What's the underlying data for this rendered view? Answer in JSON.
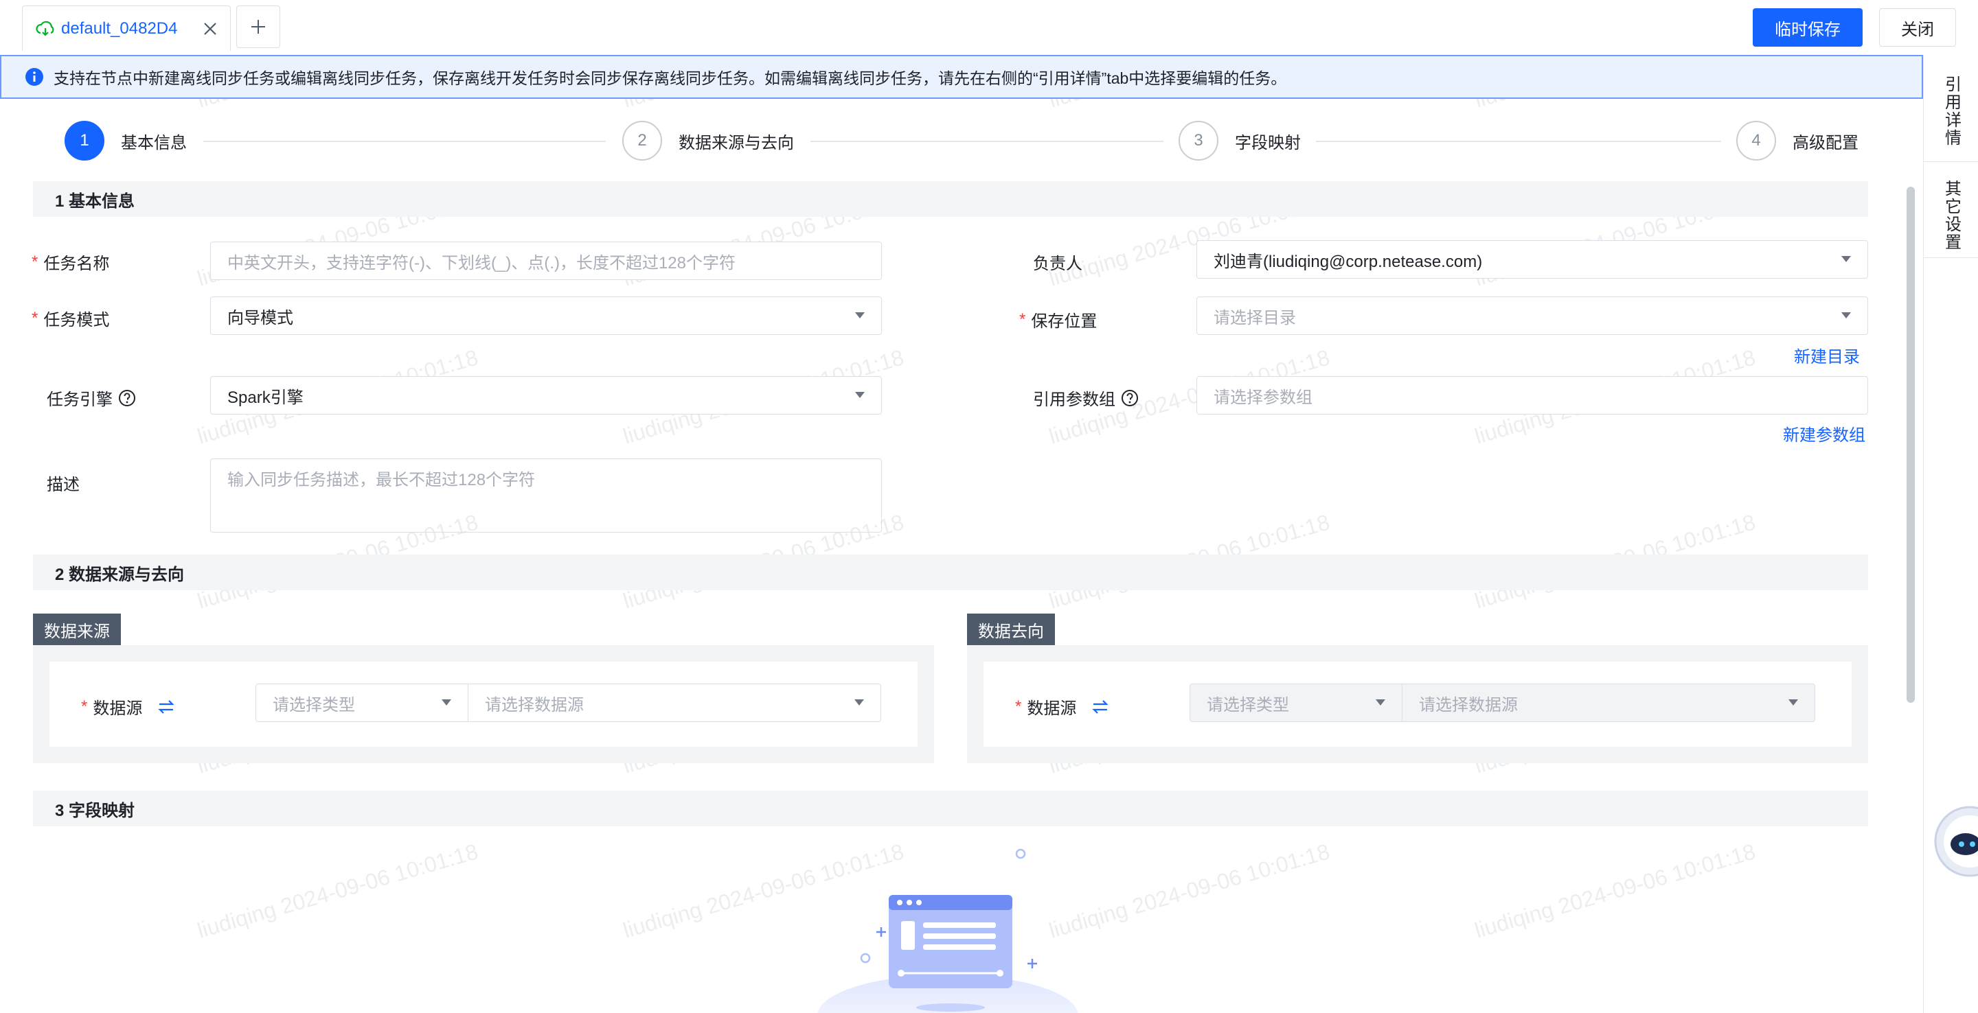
{
  "tab": {
    "label": "default_0482D4"
  },
  "actions": {
    "save_label": "临时保存",
    "close_label": "关闭"
  },
  "banner": {
    "text": "支持在节点中新建离线同步任务或编辑离线同步任务，保存离线开发任务时会同步保存离线同步任务。如需编辑离线同步任务，请先在右侧的“引用详情”tab中选择要编辑的任务。"
  },
  "side_tabs": [
    "引用详情",
    "其它设置"
  ],
  "steps": [
    {
      "num": "1",
      "label": "基本信息"
    },
    {
      "num": "2",
      "label": "数据来源与去向"
    },
    {
      "num": "3",
      "label": "字段映射"
    },
    {
      "num": "4",
      "label": "高级配置"
    }
  ],
  "sections": {
    "basic": "1 基本信息",
    "source": "2 数据来源与去向",
    "mapping": "3 字段映射"
  },
  "form": {
    "task_name": {
      "label": "任务名称",
      "placeholder": "中英文开头，支持连字符(-)、下划线(_)、点(.)，长度不超过128个字符"
    },
    "owner": {
      "label": "负责人",
      "value": "刘迪青(liudiqing@corp.netease.com)"
    },
    "task_mode": {
      "label": "任务模式",
      "value": "向导模式"
    },
    "save_location": {
      "label": "保存位置",
      "placeholder": "请选择目录"
    },
    "new_dir_link": "新建目录",
    "engine": {
      "label": "任务引擎",
      "value": "Spark引擎"
    },
    "param_group": {
      "label": "引用参数组",
      "placeholder": "请选择参数组"
    },
    "new_param_link": "新建参数组",
    "description": {
      "label": "描述",
      "placeholder": "输入同步任务描述，最长不超过128个字符"
    }
  },
  "source_panel": {
    "title": "数据来源",
    "ds_label": "数据源",
    "type_placeholder": "请选择类型",
    "ds_placeholder": "请选择数据源"
  },
  "target_panel": {
    "title": "数据去向",
    "ds_label": "数据源",
    "type_placeholder": "请选择类型",
    "ds_placeholder": "请选择数据源"
  },
  "watermark": "liudiqing 2024-09-06 10:01:18",
  "colors": {
    "primary": "#1664ff",
    "required": "#f53f3f",
    "banner_bg": "#eaf1ff"
  }
}
